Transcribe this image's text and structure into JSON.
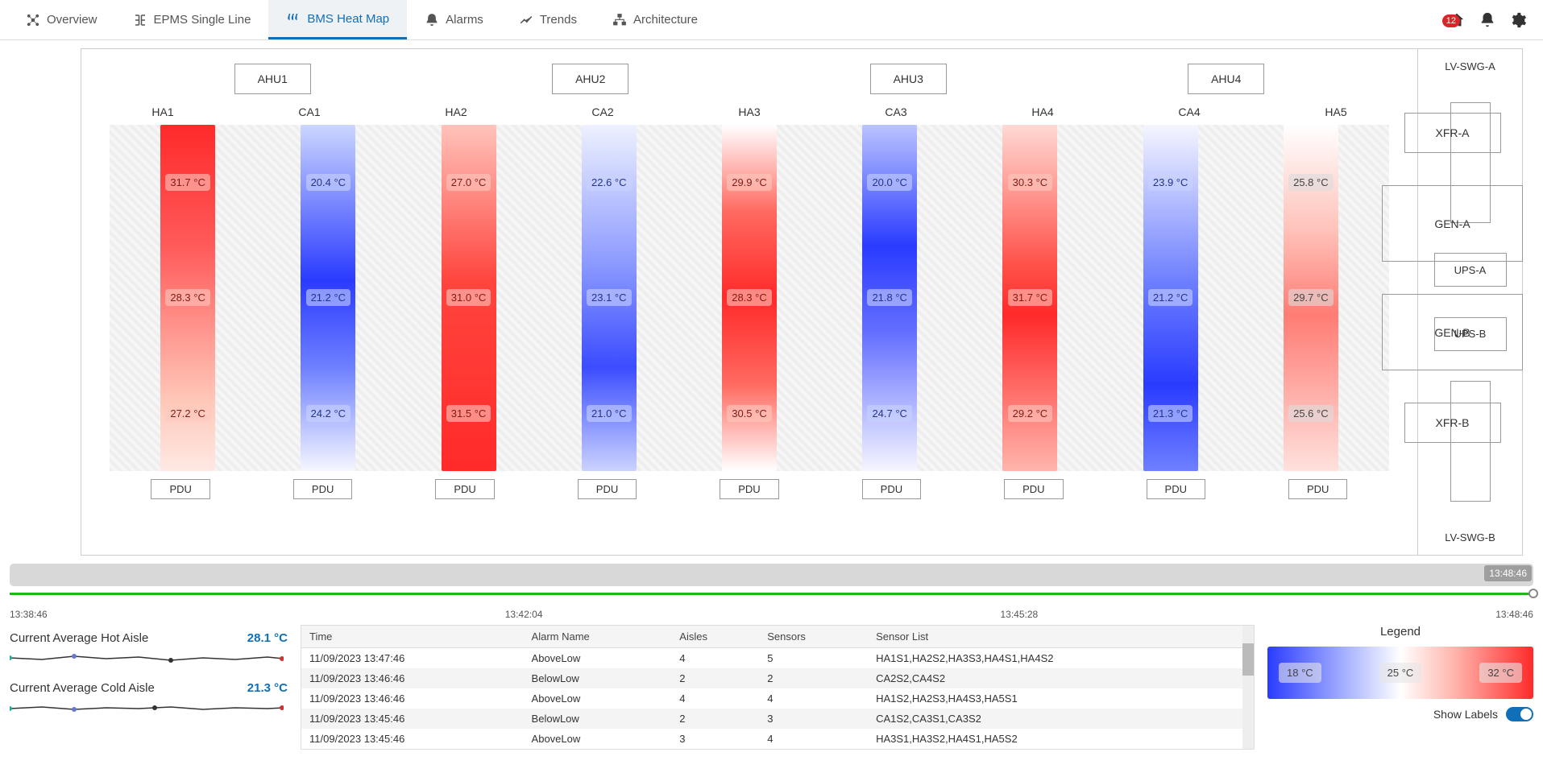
{
  "tabs": [
    {
      "label": "Overview"
    },
    {
      "label": "EPMS Single Line"
    },
    {
      "label": "BMS Heat Map"
    },
    {
      "label": "Alarms"
    },
    {
      "label": "Trends"
    },
    {
      "label": "Architecture"
    }
  ],
  "active_tab": 2,
  "notify_count": "12",
  "ahus": [
    "AHU1",
    "AHU2",
    "AHU3",
    "AHU4"
  ],
  "aisles": [
    {
      "name": "HA1",
      "style": "hot-1",
      "temps": [
        "31.7 °C",
        "28.3 °C",
        "27.2 °C"
      ]
    },
    {
      "name": "CA1",
      "style": "cold-1",
      "temps": [
        "20.4 °C",
        "21.2 °C",
        "24.2 °C"
      ]
    },
    {
      "name": "HA2",
      "style": "hot-2",
      "temps": [
        "27.0 °C",
        "31.0 °C",
        "31.5 °C"
      ]
    },
    {
      "name": "CA2",
      "style": "cold-2",
      "temps": [
        "22.6 °C",
        "23.1 °C",
        "21.0 °C"
      ]
    },
    {
      "name": "HA3",
      "style": "hot-3",
      "temps": [
        "29.9 °C",
        "28.3 °C",
        "30.5 °C"
      ]
    },
    {
      "name": "CA3",
      "style": "cold-3",
      "temps": [
        "20.0 °C",
        "21.8 °C",
        "24.7 °C"
      ]
    },
    {
      "name": "HA4",
      "style": "hot-4",
      "temps": [
        "30.3 °C",
        "31.7 °C",
        "29.2 °C"
      ]
    },
    {
      "name": "CA4",
      "style": "cold-4",
      "temps": [
        "23.9 °C",
        "21.2 °C",
        "21.3 °C"
      ]
    },
    {
      "name": "HA5",
      "style": "hot-5",
      "temps": [
        "25.8 °C",
        "29.7 °C",
        "25.6 °C"
      ]
    }
  ],
  "pdu_label": "PDU",
  "elec": {
    "top": "LV-SWG-A",
    "ups_a": "UPS-A",
    "ups_b": "UPS-B",
    "bottom": "LV-SWG-B"
  },
  "side": [
    "XFR-A",
    "GEN-A",
    "GEN-B",
    "XFR-B"
  ],
  "timeline": {
    "cursor": "13:48:46",
    "ticks": [
      "13:38:46",
      "13:42:04",
      "13:45:28",
      "13:48:46"
    ]
  },
  "metrics": {
    "hot_label": "Current Average Hot Aisle",
    "hot_val": "28.1 °C",
    "cold_label": "Current Average Cold Aisle",
    "cold_val": "21.3 °C"
  },
  "alarms": {
    "headers": [
      "Time",
      "Alarm Name",
      "Aisles",
      "Sensors",
      "Sensor List"
    ],
    "rows": [
      [
        "11/09/2023 13:47:46",
        "AboveLow",
        "4",
        "5",
        "HA1S1,HA2S2,HA3S3,HA4S1,HA4S2"
      ],
      [
        "11/09/2023 13:46:46",
        "BelowLow",
        "2",
        "2",
        "CA2S2,CA4S2"
      ],
      [
        "11/09/2023 13:46:46",
        "AboveLow",
        "4",
        "4",
        "HA1S2,HA2S3,HA4S3,HA5S1"
      ],
      [
        "11/09/2023 13:45:46",
        "BelowLow",
        "2",
        "3",
        "CA1S2,CA3S1,CA3S2"
      ],
      [
        "11/09/2023 13:45:46",
        "AboveLow",
        "3",
        "4",
        "HA3S1,HA3S2,HA4S1,HA5S2"
      ]
    ]
  },
  "legend": {
    "title": "Legend",
    "low": "18 °C",
    "mid": "25 °C",
    "high": "32 °C",
    "toggle": "Show Labels"
  }
}
